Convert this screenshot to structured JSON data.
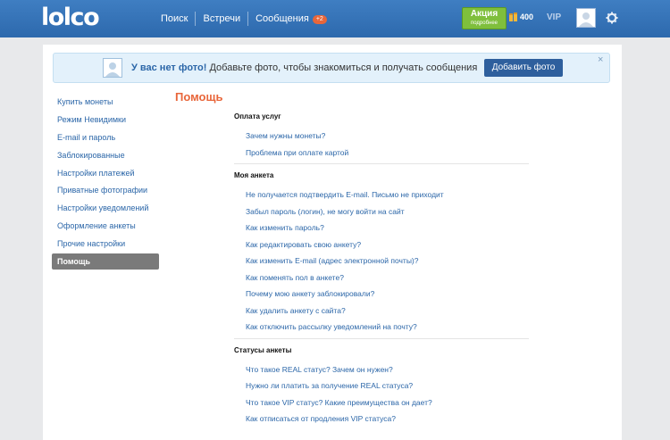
{
  "header": {
    "logo": "lolco",
    "nav": [
      {
        "label": "Поиск"
      },
      {
        "label": "Встречи"
      },
      {
        "label": "Сообщения",
        "badge": "+2"
      }
    ],
    "promo": {
      "title": "Акция",
      "subtitle": "подробнее"
    },
    "coins": "400",
    "vip": "VIP",
    "icons": {
      "coin": "coin-stack-icon",
      "settings": "gear-icon",
      "avatar": "user-avatar-icon"
    }
  },
  "alert": {
    "bold": "У вас нет фото!",
    "text": "Добавьте фото, чтобы знакомиться и получать сообщения",
    "button": "Добавить фото",
    "close": "×"
  },
  "sidebar": {
    "items": [
      {
        "label": "Купить монеты"
      },
      {
        "label": "Режим Невидимки"
      },
      {
        "label": "E-mail и пароль"
      },
      {
        "label": "Заблокированные"
      },
      {
        "label": "Настройки платежей"
      },
      {
        "label": "Приватные фотографии"
      },
      {
        "label": "Настройки уведомлений"
      },
      {
        "label": "Оформление анкеты"
      },
      {
        "label": "Прочие настройки"
      },
      {
        "label": "Помощь",
        "active": true
      }
    ]
  },
  "main": {
    "title": "Помощь",
    "sections": [
      {
        "title": "Оплата услуг",
        "links": [
          "Зачем нужны монеты?",
          "Проблема при оплате картой"
        ]
      },
      {
        "title": "Моя анкета",
        "links": [
          "Не получается подтвердить E-mail. Письмо не приходит",
          "Забыл пароль (логин), не могу войти на сайт",
          "Как изменить пароль?",
          "Как редактировать свою анкету?",
          "Как изменить E-mail (адрес электронной почты)?",
          "Как поменять пол в анкете?",
          "Почему мою анкету заблокировали?",
          "Как удалить анкету с сайта?",
          "Как отключить рассылку уведомлений на почту?"
        ]
      },
      {
        "title": "Статусы анкеты",
        "links": [
          "Что такое REAL статус? Зачем он нужен?",
          "Нужно ли платить за получение REAL статуса?",
          "Что такое VIP статус? Какие преимущества он дает?",
          "Как отписаться от продления VIP статуса?"
        ]
      }
    ]
  }
}
